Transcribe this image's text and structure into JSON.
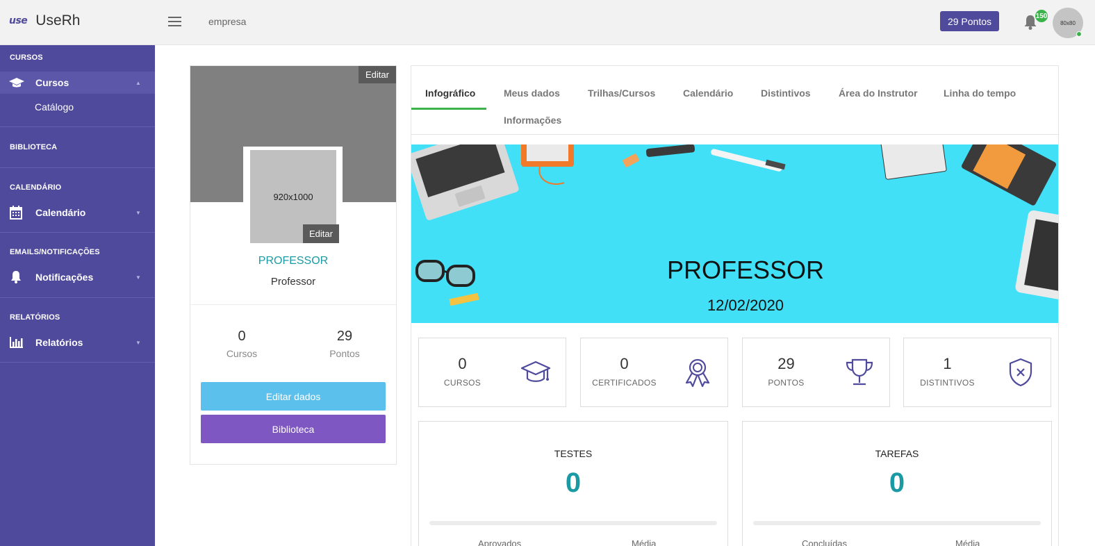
{
  "app": {
    "logo_mark": "use",
    "name": "UseRh",
    "company": "empresa"
  },
  "topbar": {
    "points_label": "29 Pontos",
    "notification_count": "150",
    "avatar_text": "80x80"
  },
  "sidebar": {
    "sections": [
      {
        "heading": "CURSOS",
        "items": [
          {
            "label": "Cursos",
            "icon": "graduation-cap-icon",
            "active": true,
            "sub": [
              {
                "label": "Catálogo"
              }
            ]
          }
        ]
      },
      {
        "heading": "BIBLIOTECA",
        "items": []
      },
      {
        "heading": "CALENDÁRIO",
        "items": [
          {
            "label": "Calendário",
            "icon": "calendar-icon"
          }
        ]
      },
      {
        "heading": "EMAILS/NOTIFICAÇÕES",
        "items": [
          {
            "label": "Notificações",
            "icon": "bell-icon"
          }
        ]
      },
      {
        "heading": "RELATÓRIOS",
        "items": [
          {
            "label": "Relatórios",
            "icon": "bar-chart-icon"
          }
        ]
      }
    ]
  },
  "profile": {
    "edit_cover": "Editar",
    "photo_placeholder": "920x1000",
    "edit_photo": "Editar",
    "name": "PROFESSOR",
    "role": "Professor",
    "stats": [
      {
        "value": "0",
        "label": "Cursos"
      },
      {
        "value": "29",
        "label": "Pontos"
      }
    ],
    "edit_button": "Editar dados",
    "library_button": "Biblioteca"
  },
  "tabs": [
    {
      "label": "Infográfico",
      "active": true
    },
    {
      "label": "Meus dados"
    },
    {
      "label": "Trilhas/Cursos"
    },
    {
      "label": "Calendário"
    },
    {
      "label": "Distintivos"
    },
    {
      "label": "Área do Instrutor"
    },
    {
      "label": "Linha do tempo"
    },
    {
      "label": "Informações"
    }
  ],
  "hero": {
    "title": "PROFESSOR",
    "date": "12/02/2020",
    "background_color": "#41e0f7"
  },
  "kpis": [
    {
      "value": "0",
      "label": "CURSOS",
      "icon": "graduation-cap-icon"
    },
    {
      "value": "0",
      "label": "CERTIFICADOS",
      "icon": "award-ribbon-icon"
    },
    {
      "value": "29",
      "label": "PONTOS",
      "icon": "trophy-icon"
    },
    {
      "value": "1",
      "label": "DISTINTIVOS",
      "icon": "shield-icon"
    }
  ],
  "panels": [
    {
      "title": "TESTES",
      "value": "0",
      "sub_left": "Aprovados",
      "sub_right": "Média"
    },
    {
      "title": "TAREFAS",
      "value": "0",
      "sub_left": "Concluídas",
      "sub_right": "Média"
    }
  ],
  "colors": {
    "brand": "#4f4a9b",
    "accent_teal": "#1b9aa3",
    "active_tab": "#3cb34a",
    "edit_button": "#5bc0eb",
    "library_button": "#7e57c2"
  }
}
